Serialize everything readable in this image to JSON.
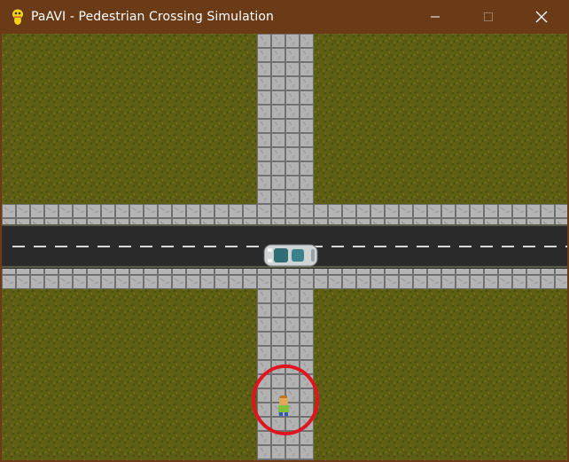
{
  "window": {
    "title": "PaAVI - Pedestrian Crossing Simulation",
    "app_icon": "pygame-snake-icon",
    "controls": {
      "minimize": "minimize-icon",
      "maximize": "maximize-icon",
      "close": "close-icon"
    }
  },
  "colors": {
    "titlebar": "#6b3a17",
    "grass": "#5e5e14",
    "road": "#2a2a2a",
    "sidewalk": "#a9a9a9",
    "highlight_circle": "#e0141e"
  },
  "scene": {
    "objects": [
      "grass",
      "horizontal-road",
      "sidewalk-top",
      "sidewalk-bottom",
      "vertical-walkway",
      "car",
      "pedestrian",
      "highlight-circle"
    ]
  }
}
